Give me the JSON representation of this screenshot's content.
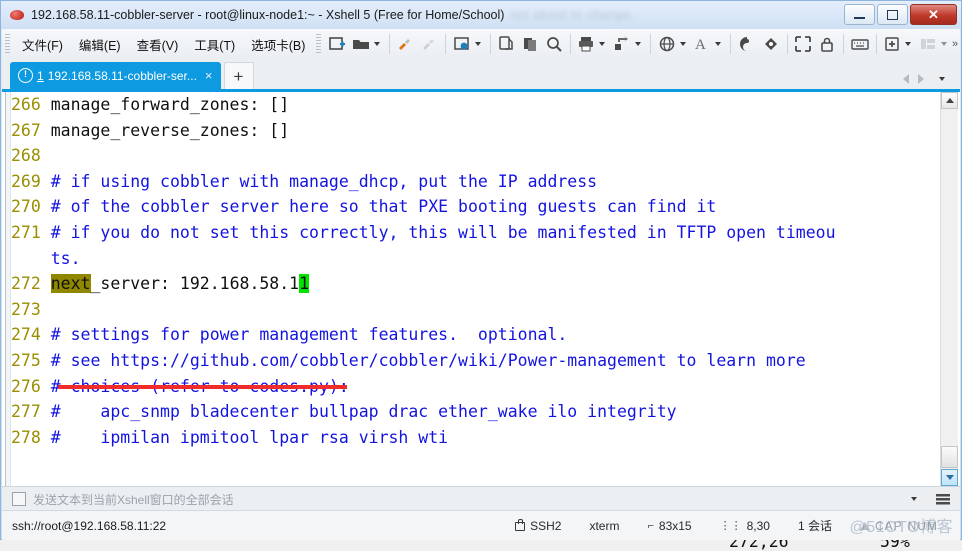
{
  "window": {
    "title": "192.168.58.11-cobbler-server - root@linux-node1:~ - Xshell 5 (Free for Home/School)",
    "blurred_suffix": "not about to change.",
    "minimize_label": "Minimize",
    "maximize_label": "Maximize",
    "close_label": "✕"
  },
  "menubar": {
    "items": [
      {
        "label": "文件(F)",
        "name": "menu-file"
      },
      {
        "label": "编辑(E)",
        "name": "menu-edit"
      },
      {
        "label": "查看(V)",
        "name": "menu-view"
      },
      {
        "label": "工具(T)",
        "name": "menu-tools"
      },
      {
        "label": "选项卡(B)",
        "name": "menu-tabs"
      }
    ],
    "toolbar_icons": [
      "new-session-icon",
      "open-folder-icon",
      "connect-icon",
      "disconnect-icon",
      "session-properties-icon",
      "copy-icon",
      "paste-icon",
      "find-icon",
      "print-icon",
      "transfer-icon",
      "globe-icon",
      "font-icon",
      "log-icon",
      "compose-icon",
      "fullscreen-icon",
      "lock-icon",
      "keyboard-icon",
      "add-layout-icon",
      "arrange-icon"
    ],
    "overflow_label": "»"
  },
  "tabs": {
    "active": {
      "alert_icon": "!",
      "index": "1",
      "label": "192.168.58.11-cobbler-ser...",
      "close": "×"
    },
    "new_tab_label": "+",
    "nav_prev": "prev-tab",
    "nav_next": "next-tab",
    "nav_list": "tab-list"
  },
  "terminal": {
    "lines": [
      {
        "num": "266",
        "segments": [
          {
            "t": "manage_forward_zones: []",
            "c": "tx"
          }
        ]
      },
      {
        "num": "267",
        "segments": [
          {
            "t": "manage_reverse_zones: []",
            "c": "tx"
          }
        ]
      },
      {
        "num": "268",
        "segments": [
          {
            "t": "",
            "c": "tx"
          }
        ]
      },
      {
        "num": "269",
        "segments": [
          {
            "t": "# if using cobbler with manage_dhcp, put the IP address",
            "c": "cm"
          }
        ]
      },
      {
        "num": "270",
        "segments": [
          {
            "t": "# of the cobbler server here so that PXE booting guests can find it",
            "c": "cm"
          }
        ]
      },
      {
        "num": "271",
        "segments": [
          {
            "t": "# if you do not set this correctly, this will be manifested in TFTP open timeou",
            "c": "cm"
          }
        ]
      },
      {
        "num": "",
        "segments": [
          {
            "t": "ts.",
            "c": "cm"
          }
        ]
      },
      {
        "num": "272",
        "segments": [
          {
            "t": "next",
            "c": "tx",
            "hl": "olive"
          },
          {
            "t": "_server: 192.168.58.1",
            "c": "tx"
          },
          {
            "t": "1",
            "c": "tx",
            "hl": "green"
          }
        ]
      },
      {
        "num": "273",
        "segments": [
          {
            "t": "",
            "c": "tx"
          }
        ]
      },
      {
        "num": "274",
        "segments": [
          {
            "t": "# settings for power management features.  optional.",
            "c": "cm"
          }
        ]
      },
      {
        "num": "275",
        "segments": [
          {
            "t": "# see https://github.com/cobbler/cobbler/wiki/Power-management to learn more",
            "c": "cm"
          }
        ]
      },
      {
        "num": "276",
        "segments": [
          {
            "t": "# choices (refer to codes.py):",
            "c": "cm"
          }
        ]
      },
      {
        "num": "277",
        "segments": [
          {
            "t": "#    apc_snmp bladecenter bullpap drac ether_wake ilo integrity",
            "c": "cm"
          }
        ]
      },
      {
        "num": "278",
        "segments": [
          {
            "t": "#    ipmilan ipmitool lpar rsa virsh wti",
            "c": "cm"
          }
        ]
      }
    ],
    "cursor_position": "272,26",
    "scroll_percent": "59%"
  },
  "sendbar": {
    "checkbox_label": "发送文本到当前Xshell窗口的全部会话",
    "dropdown": "send-options",
    "menu": "send-menu"
  },
  "statusbar": {
    "url": "ssh://root@192.168.58.11:22",
    "protocol": "SSH2",
    "term_type": "xterm",
    "size": "83x15",
    "cursor": "8,30",
    "sessions": "1 会话",
    "cap": "CAP",
    "num": "NUM",
    "watermark": "@51CTO博客"
  },
  "colors": {
    "accent": "#0e9ae0",
    "comment": "#1414e0",
    "linenum": "#9a8f00",
    "search_highlight": "#8f8700",
    "cursor_highlight": "#00e400",
    "underline": "#ef2b2b",
    "close_button": "#c0392b"
  }
}
